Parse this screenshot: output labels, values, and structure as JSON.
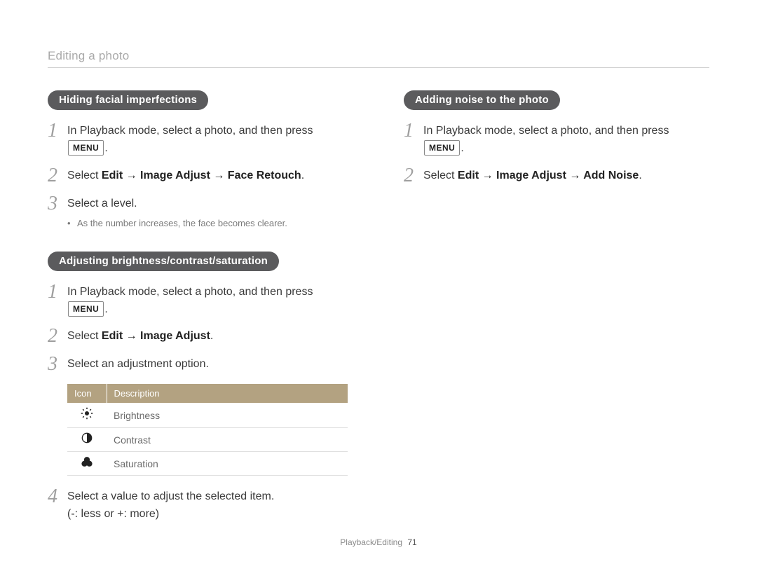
{
  "breadcrumb": "Editing a photo",
  "menu_key": "MENU",
  "arrow": "→",
  "left": {
    "section1": {
      "pill": "Hiding facial imperfections",
      "steps": [
        {
          "n": "1",
          "pre": "In Playback mode, select a photo, and then press ",
          "post": "."
        },
        {
          "n": "2",
          "text_prefix": "Select ",
          "bold": "Edit → Image Adjust → Face Retouch",
          "text_suffix": "."
        },
        {
          "n": "3",
          "plain": "Select a level.",
          "note": "As the number increases, the face becomes clearer."
        }
      ]
    },
    "section2": {
      "pill": "Adjusting brightness/contrast/saturation",
      "steps": [
        {
          "n": "1",
          "pre": "In Playback mode, select a photo, and then press ",
          "post": "."
        },
        {
          "n": "2",
          "text_prefix": "Select ",
          "bold": "Edit → Image Adjust",
          "text_suffix": "."
        },
        {
          "n": "3",
          "plain": "Select an adjustment option."
        },
        {
          "n": "4",
          "plain": "Select a value to adjust the selected item.",
          "sub": "(-: less or +: more)"
        }
      ],
      "table": {
        "headers": [
          "Icon",
          "Description"
        ],
        "rows": [
          {
            "icon": "brightness",
            "desc": "Brightness"
          },
          {
            "icon": "contrast",
            "desc": "Contrast"
          },
          {
            "icon": "saturation",
            "desc": "Saturation"
          }
        ]
      }
    }
  },
  "right": {
    "section1": {
      "pill": "Adding noise to the photo",
      "steps": [
        {
          "n": "1",
          "pre": "In Playback mode, select a photo, and then press ",
          "post": "."
        },
        {
          "n": "2",
          "text_prefix": "Select ",
          "bold": "Edit → Image Adjust → Add Noise",
          "text_suffix": "."
        }
      ]
    }
  },
  "footer": {
    "section": "Playback/Editing",
    "page": "71"
  }
}
